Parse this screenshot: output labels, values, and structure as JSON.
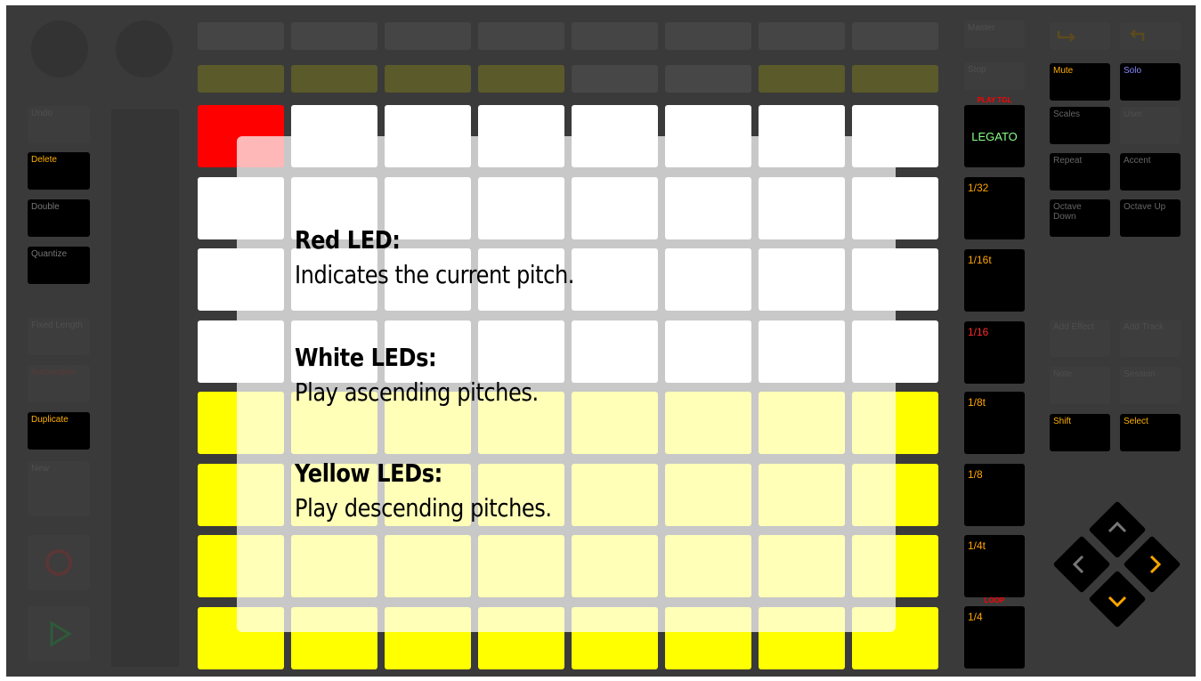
{
  "left_buttons": {
    "undo": "Undo",
    "delete": "Delete",
    "double": "Double",
    "quantize": "Quantize",
    "fixed_length": "Fixed Length",
    "automation": "Automation",
    "duplicate": "Duplicate",
    "new": "New"
  },
  "scene_column": {
    "master": "Master",
    "stop": "Stop",
    "play_tgl": "PLAY TGL",
    "legato": "LEGATO",
    "r1_32": "1/32",
    "r1_16t": "1/16t",
    "r1_16": "1/16",
    "r1_8t": "1/8t",
    "r1_8": "1/8",
    "r1_4t": "1/4t",
    "loop": "LOOP",
    "r1_4": "1/4"
  },
  "right_buttons": {
    "mute": "Mute",
    "solo": "Solo",
    "scales": "Scales",
    "user": "User",
    "repeat": "Repeat",
    "accent": "Accent",
    "octave_down": "Octave Down",
    "octave_up": "Octave Up",
    "add_effect": "Add Effect",
    "add_track": "Add Track",
    "note": "Note",
    "session": "Session",
    "shift": "Shift",
    "select": "Select"
  },
  "grid": {
    "rows": [
      [
        "red",
        "white",
        "white",
        "white",
        "white",
        "white",
        "white",
        "white"
      ],
      [
        "white",
        "white",
        "white",
        "white",
        "white",
        "white",
        "white",
        "white"
      ],
      [
        "white",
        "white",
        "white",
        "white",
        "white",
        "white",
        "white",
        "white"
      ],
      [
        "white",
        "white",
        "white",
        "white",
        "white",
        "white",
        "white",
        "white"
      ],
      [
        "yellow",
        "yellow",
        "yellow",
        "yellow",
        "yellow",
        "yellow",
        "yellow",
        "yellow"
      ],
      [
        "yellow",
        "yellow",
        "yellow",
        "yellow",
        "yellow",
        "yellow",
        "yellow",
        "yellow"
      ],
      [
        "yellow",
        "yellow",
        "yellow",
        "yellow",
        "yellow",
        "yellow",
        "yellow",
        "yellow"
      ],
      [
        "yellow",
        "yellow",
        "yellow",
        "yellow",
        "yellow",
        "yellow",
        "yellow",
        "yellow"
      ]
    ],
    "top_row_2_colors": [
      "olive",
      "olive",
      "olive",
      "olive",
      "dark",
      "dark",
      "olive",
      "olive"
    ]
  },
  "overlay": {
    "red_heading": "Red LED:",
    "red_body": "Indicates the current pitch.",
    "white_heading": "White LEDs:",
    "white_body": "Play ascending pitches.",
    "yellow_heading": "Yellow LEDs:",
    "yellow_body": "Play descending pitches."
  },
  "colors": {
    "pad_white": "#ffffff",
    "pad_yellow": "#ffff00",
    "pad_red": "#ff0000",
    "legato_green": "#88ff88",
    "accent_orange": "#ffa500"
  }
}
